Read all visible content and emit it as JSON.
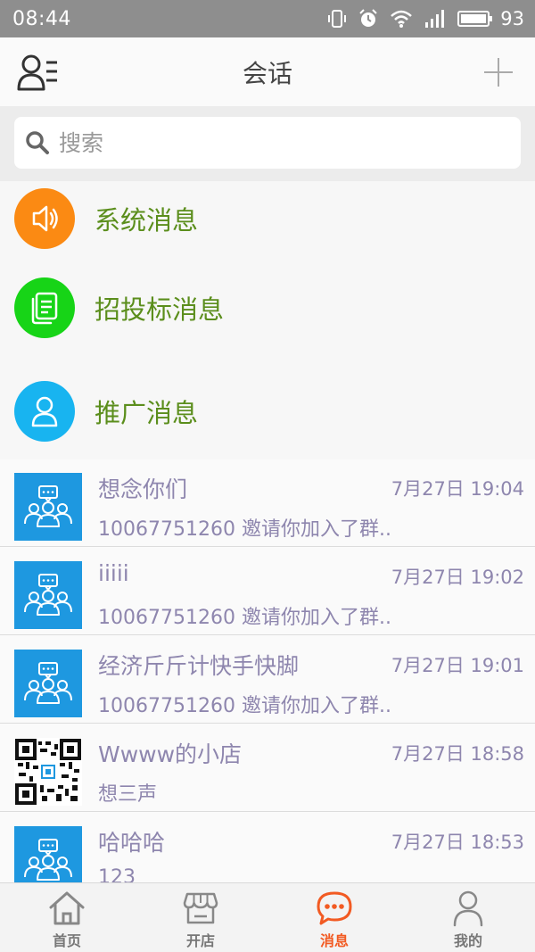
{
  "status_bar": {
    "time": "08:44",
    "battery": "93"
  },
  "header": {
    "title": "会话"
  },
  "search": {
    "placeholder": "搜索"
  },
  "system_items": [
    {
      "label": "系统消息",
      "icon": "speaker-icon",
      "color": "#fb8a13"
    },
    {
      "label": "招投标消息",
      "icon": "document-icon",
      "color": "#17d417"
    },
    {
      "label": "推广消息",
      "icon": "person-icon",
      "color": "#18b4f0"
    }
  ],
  "conversations": [
    {
      "name": "想念你们",
      "time": "7月27日 19:04",
      "preview": "10067751260 邀请你加入了群..",
      "avatar": "group-chat-icon"
    },
    {
      "name": "iiiii",
      "time": "7月27日 19:02",
      "preview": "10067751260 邀请你加入了群..",
      "avatar": "group-chat-icon"
    },
    {
      "name": "经济斤斤计快手快脚",
      "time": "7月27日 19:01",
      "preview": "10067751260 邀请你加入了群..",
      "avatar": "group-chat-icon"
    },
    {
      "name": "Wwww的小店",
      "time": "7月27日 18:58",
      "preview": "想三声",
      "avatar": "qr-code-icon"
    },
    {
      "name": "哈哈哈",
      "time": "7月27日 18:53",
      "preview": "123",
      "avatar": "group-chat-icon"
    }
  ],
  "tabs": [
    {
      "label": "首页",
      "icon": "home-icon",
      "active": false
    },
    {
      "label": "开店",
      "icon": "shop-icon",
      "active": false
    },
    {
      "label": "消息",
      "icon": "chat-bubble-icon",
      "active": true
    },
    {
      "label": "我的",
      "icon": "user-icon",
      "active": false
    }
  ],
  "colors": {
    "accent": "#f25a22",
    "system_label": "#5b8e1c",
    "list_text": "#8e86ae",
    "avatar_blue": "#1e98e0"
  }
}
